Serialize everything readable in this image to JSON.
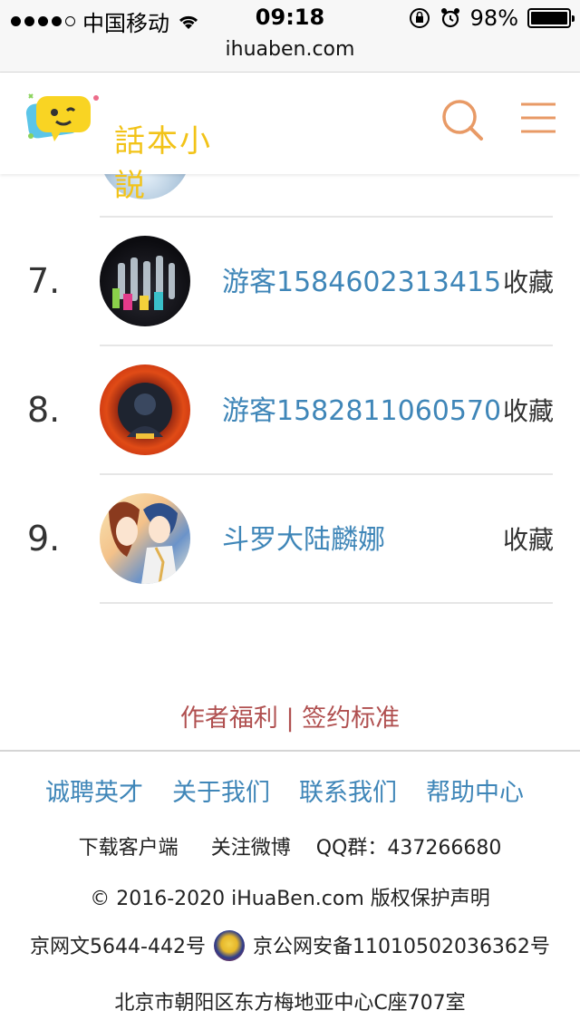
{
  "status_bar": {
    "carrier": "中国移动",
    "time": "09:18",
    "battery": "98%",
    "battery_level": 0.98
  },
  "url": "ihuaben.com",
  "header": {
    "logo_text": "話本小説"
  },
  "ranking": [
    {
      "rank": "7.",
      "name": "游客1584602313415",
      "action": "收藏"
    },
    {
      "rank": "8.",
      "name": "游客1582811060570",
      "action": "收藏"
    },
    {
      "rank": "9.",
      "name": "斗罗大陆麟娜",
      "action": "收藏"
    }
  ],
  "footer": {
    "author_links": "作者福利 | 签约标准",
    "nav": [
      "诚聘英才",
      "关于我们",
      "联系我们",
      "帮助中心"
    ],
    "download": "下载客户端",
    "weibo": "关注微博",
    "qq": "QQ群：437266680",
    "copyright": "© 2016-2020 iHuaBen.com 版权保护声明",
    "license_1": "京网文5644-442号",
    "license_2": "京公网安备11010502036362号",
    "address": "北京市朝阳区东方梅地亚中心C座707室"
  }
}
